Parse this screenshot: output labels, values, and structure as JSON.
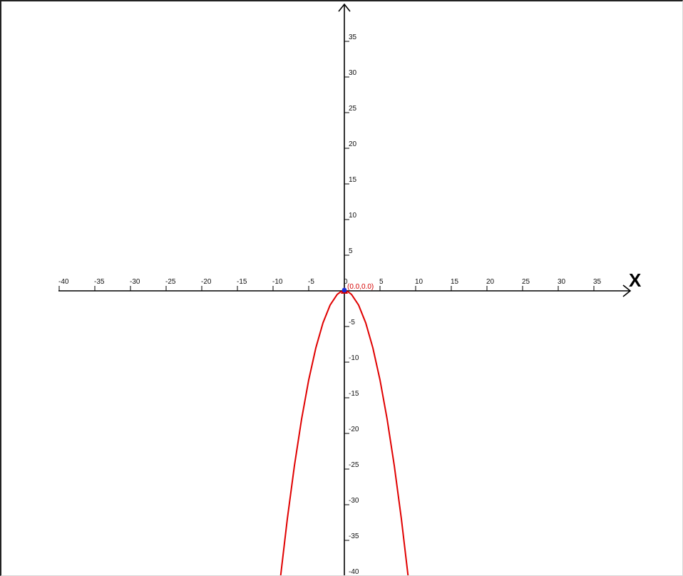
{
  "chart_data": {
    "type": "line",
    "title": "",
    "xlabel": "X",
    "ylabel": "",
    "xlim": [
      -40,
      40
    ],
    "ylim": [
      -40,
      40
    ],
    "x_ticks": [
      -40,
      -35,
      -30,
      -25,
      -20,
      -15,
      -10,
      -5,
      0,
      5,
      10,
      15,
      20,
      25,
      30,
      35
    ],
    "y_ticks": [
      35,
      30,
      25,
      20,
      15,
      10,
      5,
      -5,
      -10,
      -15,
      -20,
      -25,
      -30,
      -35,
      -40
    ],
    "grid": false,
    "series": [
      {
        "color": "#e00000",
        "x": [
          -8.94,
          -8,
          -7,
          -6,
          -5,
          -4,
          -3,
          -2,
          -1,
          -0.5,
          0,
          0.5,
          1,
          2,
          3,
          4,
          5,
          6,
          7,
          8,
          8.94
        ],
        "y": [
          -40,
          -32,
          -24.5,
          -18,
          -12.5,
          -8,
          -4.5,
          -2,
          -0.5,
          -0.125,
          0,
          -0.125,
          -0.5,
          -2,
          -4.5,
          -8,
          -12.5,
          -18,
          -24.5,
          -32,
          -40
        ]
      }
    ],
    "points": [
      {
        "x": 0,
        "y": 0,
        "label": "(0.0,0.0)",
        "marker_color": "#1a2fd6",
        "label_color": "#d40000"
      }
    ]
  }
}
